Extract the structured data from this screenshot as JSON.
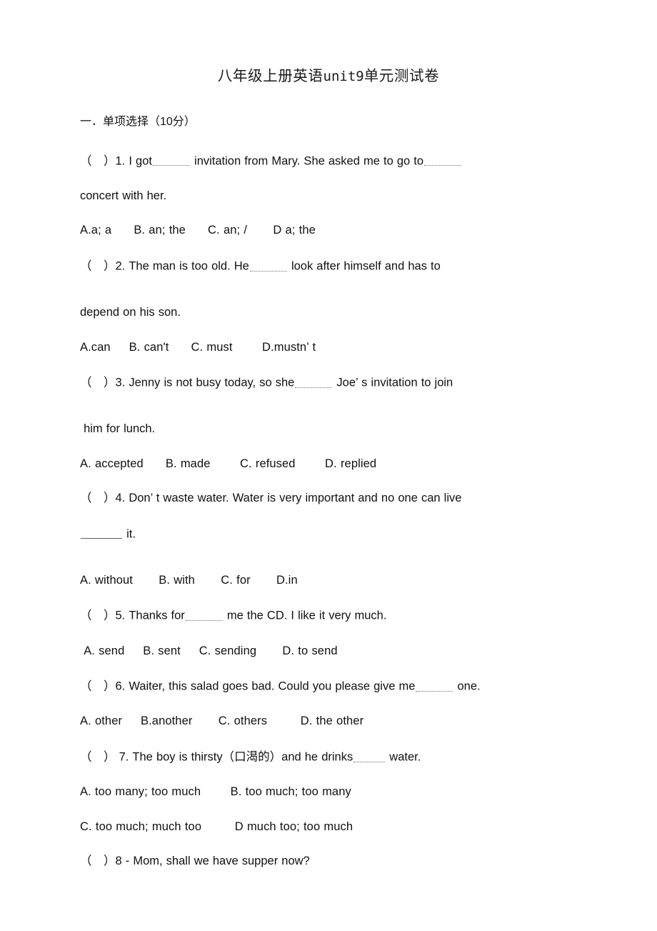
{
  "document": {
    "title_cjk_prefix": "八年级上册英语",
    "title_latin": "unit9",
    "title_cjk_suffix": "单元测试卷",
    "title_full": "八年级上册英语unit9单元测试卷",
    "background_color": "#ffffff",
    "text_color": "#111111",
    "blank_rule_color": "#6f6f6f"
  },
  "sections": [
    {
      "heading": "一．单项选择（10分）",
      "questions": [
        {
          "number": "1",
          "bracket": "（　）",
          "stem_part_1": "（　）1. I got",
          "stem_part_2": " invitation from Mary. She asked me to go to",
          "stem_wrap": "concert with her.",
          "options": "A.a; a      B. an; the      C. an; /       D a; the"
        },
        {
          "number": "2",
          "bracket": "（　）",
          "stem_part_1": "（　）2. The man is too old. He",
          "stem_part_2": " look after himself and has to",
          "stem_wrap": "depend on his son.",
          "options": "A.can     B. can't      C. must        D.mustn’ t"
        },
        {
          "number": "3",
          "bracket": "（　）",
          "stem_part_1": "（　）3. Jenny is not busy today, so she",
          "stem_part_2": " Joe’ s invitation to join",
          "stem_wrap": " him for lunch.",
          "options": "A. accepted      B. made        C. refused        D. replied"
        },
        {
          "number": "4",
          "bracket": "（　）",
          "stem_part_1": "（　）4. Don’ t waste water. Water is very important and no one can live",
          "stem_part_2": "",
          "stem_wrap_suffix": " it.",
          "options": "A. without       B. with       C. for       D.in"
        },
        {
          "number": "5",
          "bracket": "（　）",
          "stem_part_1": "（　）5. Thanks for",
          "stem_part_2": " me the CD. I like it very much.",
          "options": " A. send     B. sent     C. sending       D. to send"
        },
        {
          "number": "6",
          "bracket": "（　）",
          "stem_part_1": "（　）6. Waiter, this salad goes bad. Could you please give me",
          "stem_part_2": " one.",
          "options": "A. other     B.another       C. others         D. the other"
        },
        {
          "number": "7",
          "bracket": "（　）",
          "stem_part_1": "（　） 7. The boy is thirsty（口渴的）and he drinks",
          "stem_part_2": " water.",
          "options_line_1": "A. too many; too much        B. too much; too many",
          "options_line_2": "C. too much; much too         D much too; too much"
        },
        {
          "number": "8",
          "bracket": "（　）",
          "stem_part_1": "（　）8 - Mom, shall we have supper now?"
        }
      ]
    }
  ]
}
